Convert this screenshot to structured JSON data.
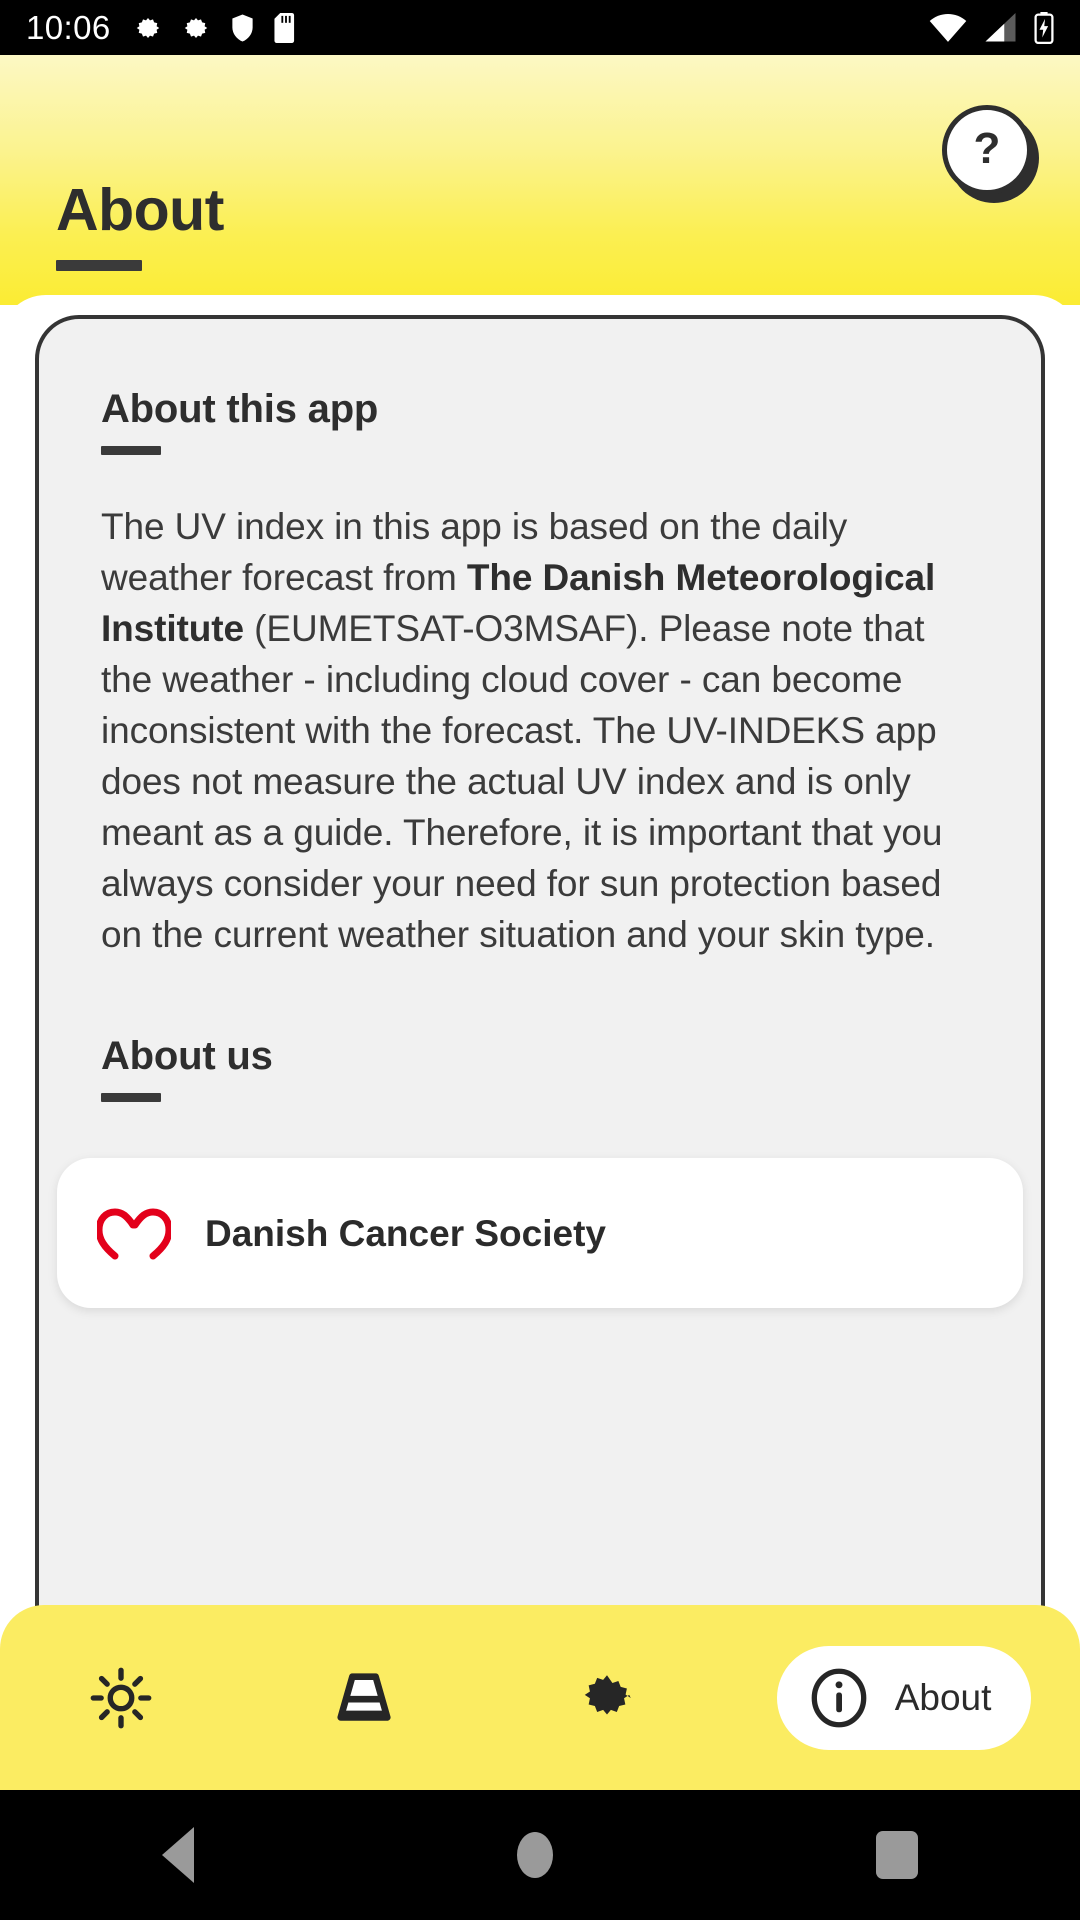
{
  "status_bar": {
    "time": "10:06",
    "left_icons": [
      "gear-icon",
      "gear-icon",
      "shield-icon",
      "sd-card-icon"
    ],
    "right_icons": [
      "wifi-icon",
      "cellular-signal-icon",
      "battery-charging-icon"
    ]
  },
  "header": {
    "title": "About",
    "help_label": "?",
    "gradient_top": "#FCF8C4",
    "gradient_bottom": "#FBEC33"
  },
  "card": {
    "about_app": {
      "heading": "About this app",
      "body_part_1": "The UV index in this app is based on the daily weather forecast from ",
      "body_bold": "The Danish Meteorological Institute",
      "body_part_2": " (EUMETSAT-O3MSAF). Please note that the weather - including cloud cover - can become inconsistent with the forecast. The UV-INDEKS app does not measure the actual UV index and is only meant as a guide. Therefore, it is important that you always consider your need for sun protection based on the current weather situation and your skin type."
    },
    "about_us": {
      "heading": "About us",
      "org_name": "Danish Cancer Society"
    }
  },
  "bottom_nav": {
    "items": [
      {
        "name": "uv-index",
        "icon": "sun-icon",
        "label": "",
        "active": false
      },
      {
        "name": "sun-protection",
        "icon": "sun-hat-icon",
        "label": "",
        "active": false
      },
      {
        "name": "settings",
        "icon": "gear-icon",
        "label": "",
        "active": false
      },
      {
        "name": "about",
        "icon": "info-icon",
        "label": "About",
        "active": true
      }
    ],
    "background": "#FBEC62"
  },
  "system_nav": {
    "back": "back-triangle",
    "home": "home-circle",
    "recents": "recents-square"
  }
}
